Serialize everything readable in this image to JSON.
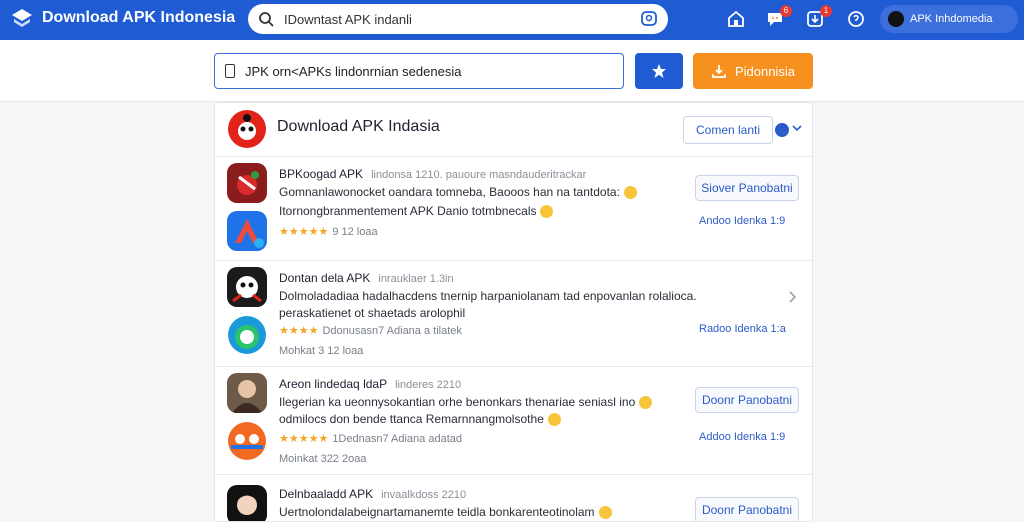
{
  "topbar": {
    "logo_text": "Download APK Indonesia",
    "search_value": "IDowntast APK indanli",
    "notif_badge_1": "6",
    "notif_badge_2": "1",
    "user_label": "APK Inhdomedia"
  },
  "subbar": {
    "input_value": "JPK orn<APKs lindonrnian sedenesia",
    "orange_label": "Pidonnisia"
  },
  "card": {
    "title": "Download APK Indasia",
    "sort_label": "Comen lanti"
  },
  "rows": [
    {
      "name": "BPKoogad APK",
      "meta": "lindonsa 1210. pauoure masndauderitrackar",
      "line1": "Gomnanlawonocket oandara tomneba, Baooos han na tantdota:",
      "line2": "Itornongbranmentement APK Danio totmbnecals",
      "stars": "★★★★★",
      "rating": "9 12 loaa",
      "action": "Siover Panobatni",
      "link": "Andoo Idenka 1:9"
    },
    {
      "name": "Dontan dela APK",
      "meta": "inrauklaer 1.3in",
      "line1": "Dolmoladadiaa hadalhacdens tnernip harpaniolanam tad enpovanlan rolalioca.",
      "line2": "peraskatienet ot shaetads arolophil",
      "stars": "★★★★",
      "rating": "Ddonusasn7 Adiana a tilatek",
      "sub": "Mohkat 3 12 loaa",
      "link": "Radoo Idenka 1:a"
    },
    {
      "name": "Areon lindedaq ldaP",
      "meta": "linderes 2210",
      "line1": "Ilegerian ka ueonnysokantian orhe benonkars thenariae seniasl ino",
      "line2": "odmilocs don bende ttanca Remarnnangmolsothe",
      "stars": "★★★★★",
      "rating": "1Dednasn7 Adiana adatad",
      "sub": "Moinkat 322 2oaa",
      "action": "Doonr Panobatni",
      "link": "Addoo Idenka 1:9"
    },
    {
      "name": "Delnbaaladd APK",
      "meta": "invaalkdoss 2210",
      "line1": "Uertnolondalabeignartamanemte teidla bonkarenteotinolam",
      "action": "Doonr Panobatni"
    }
  ]
}
